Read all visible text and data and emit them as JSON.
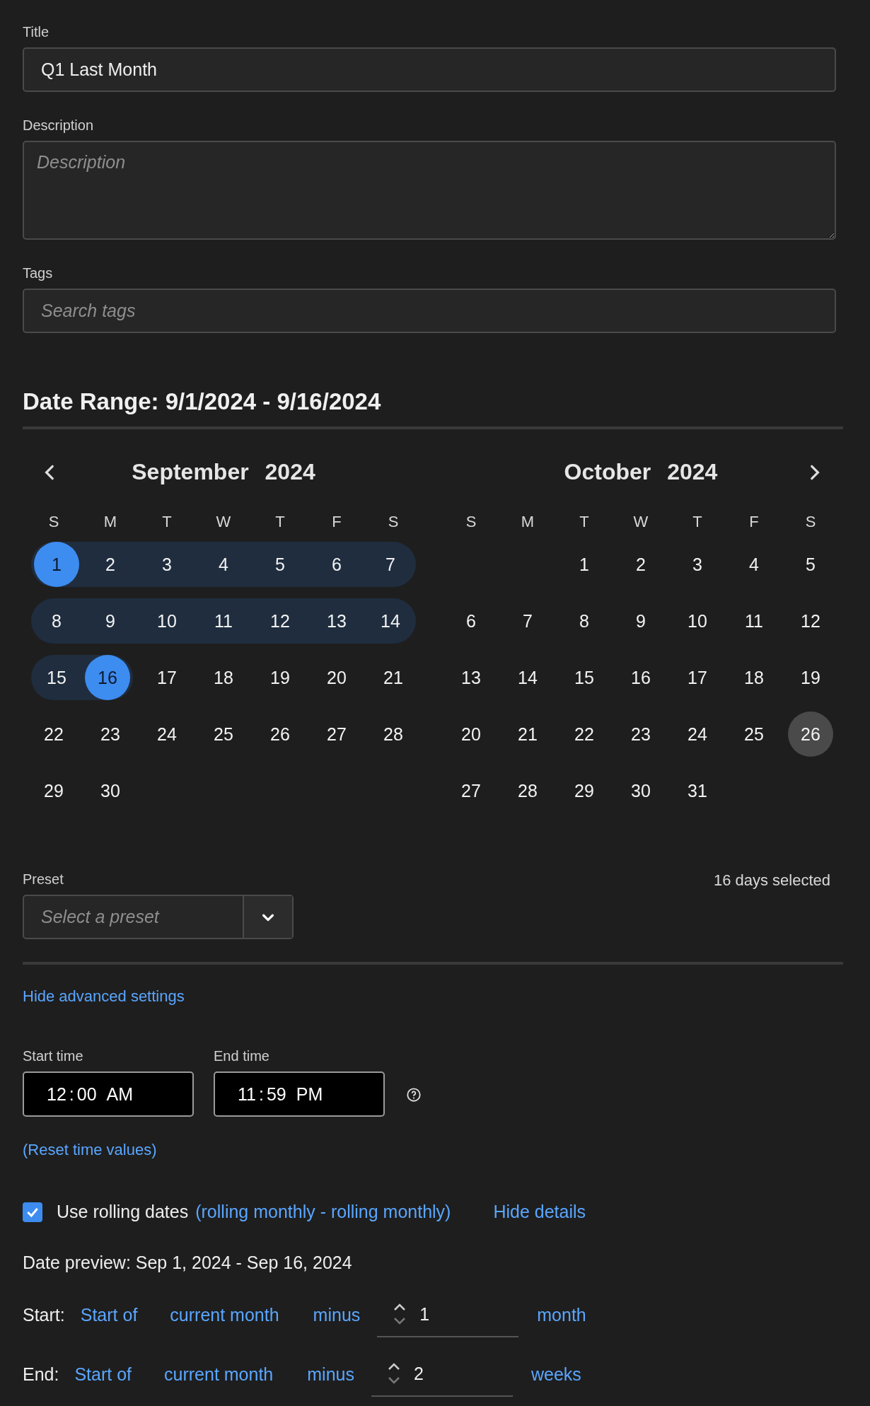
{
  "form": {
    "title": {
      "label": "Title",
      "value": "Q1 Last Month"
    },
    "description": {
      "label": "Description",
      "placeholder": "Description"
    },
    "tags": {
      "label": "Tags",
      "placeholder": "Search tags"
    }
  },
  "date_range": {
    "heading": "Date Range: 9/1/2024 - 9/16/2024"
  },
  "calendar": {
    "months": [
      {
        "month": "September",
        "year": "2024",
        "weekdays": [
          "S",
          "M",
          "T",
          "W",
          "T",
          "F",
          "S"
        ],
        "weeks": [
          [
            {
              "label": "1",
              "kind": "range_end"
            },
            {
              "label": "2",
              "kind": "range"
            },
            {
              "label": "3",
              "kind": "range"
            },
            {
              "label": "4",
              "kind": "range"
            },
            {
              "label": "5",
              "kind": "range"
            },
            {
              "label": "6",
              "kind": "range"
            },
            {
              "label": "7",
              "kind": "range"
            }
          ],
          [
            {
              "label": "8",
              "kind": "range"
            },
            {
              "label": "9",
              "kind": "range"
            },
            {
              "label": "10",
              "kind": "range"
            },
            {
              "label": "11",
              "kind": "range"
            },
            {
              "label": "12",
              "kind": "range"
            },
            {
              "label": "13",
              "kind": "range"
            },
            {
              "label": "14",
              "kind": "range"
            }
          ],
          [
            {
              "label": "15",
              "kind": "range"
            },
            {
              "label": "16",
              "kind": "range_end"
            },
            {
              "label": "17",
              "kind": "day"
            },
            {
              "label": "18",
              "kind": "day"
            },
            {
              "label": "19",
              "kind": "day"
            },
            {
              "label": "20",
              "kind": "day"
            },
            {
              "label": "21",
              "kind": "day"
            }
          ],
          [
            {
              "label": "22",
              "kind": "day"
            },
            {
              "label": "23",
              "kind": "day"
            },
            {
              "label": "24",
              "kind": "day"
            },
            {
              "label": "25",
              "kind": "day"
            },
            {
              "label": "26",
              "kind": "day"
            },
            {
              "label": "27",
              "kind": "day"
            },
            {
              "label": "28",
              "kind": "day"
            }
          ],
          [
            {
              "label": "29",
              "kind": "day"
            },
            {
              "label": "30",
              "kind": "day"
            }
          ]
        ]
      },
      {
        "month": "October",
        "year": "2024",
        "weekdays": [
          "S",
          "M",
          "T",
          "W",
          "T",
          "F",
          "S"
        ],
        "weeks": [
          [
            {
              "kind": "blank"
            },
            {
              "kind": "blank"
            },
            {
              "label": "1",
              "kind": "day"
            },
            {
              "label": "2",
              "kind": "day"
            },
            {
              "label": "3",
              "kind": "day"
            },
            {
              "label": "4",
              "kind": "day"
            },
            {
              "label": "5",
              "kind": "day"
            }
          ],
          [
            {
              "label": "6",
              "kind": "day"
            },
            {
              "label": "7",
              "kind": "day"
            },
            {
              "label": "8",
              "kind": "day"
            },
            {
              "label": "9",
              "kind": "day"
            },
            {
              "label": "10",
              "kind": "day"
            },
            {
              "label": "11",
              "kind": "day"
            },
            {
              "label": "12",
              "kind": "day"
            }
          ],
          [
            {
              "label": "13",
              "kind": "day"
            },
            {
              "label": "14",
              "kind": "day"
            },
            {
              "label": "15",
              "kind": "day"
            },
            {
              "label": "16",
              "kind": "day"
            },
            {
              "label": "17",
              "kind": "day"
            },
            {
              "label": "18",
              "kind": "day"
            },
            {
              "label": "19",
              "kind": "day"
            }
          ],
          [
            {
              "label": "20",
              "kind": "day"
            },
            {
              "label": "21",
              "kind": "day"
            },
            {
              "label": "22",
              "kind": "day"
            },
            {
              "label": "23",
              "kind": "day"
            },
            {
              "label": "24",
              "kind": "day"
            },
            {
              "label": "25",
              "kind": "day"
            },
            {
              "label": "26",
              "kind": "today"
            }
          ],
          [
            {
              "label": "27",
              "kind": "day"
            },
            {
              "label": "28",
              "kind": "day"
            },
            {
              "label": "29",
              "kind": "day"
            },
            {
              "label": "30",
              "kind": "day"
            },
            {
              "label": "31",
              "kind": "day"
            }
          ]
        ]
      }
    ]
  },
  "preset": {
    "label": "Preset",
    "placeholder": "Select a preset",
    "summary": "16 days selected"
  },
  "advanced": {
    "toggle": "Hide advanced settings",
    "times": [
      {
        "label": "Start time",
        "segments": [
          "12",
          ":",
          "00",
          "AM"
        ]
      },
      {
        "label": "End time",
        "segments": [
          "11",
          ":",
          "59",
          "PM"
        ]
      }
    ],
    "reset": "(Reset time values)"
  },
  "rolling": {
    "checked": true,
    "label": "Use rolling dates",
    "summary": "(rolling monthly - rolling monthly)",
    "details_link": "Hide details",
    "preview": "Date preview: Sep 1, 2024 - Sep 16, 2024",
    "rules": [
      {
        "label": "Start:",
        "anchor": "Start of",
        "period": "current month",
        "op": "minus",
        "amount": "1",
        "unit": "month"
      },
      {
        "label": "End:",
        "anchor": "Start of",
        "period": "current month",
        "op": "minus",
        "amount": "2",
        "unit": "weeks"
      }
    ]
  }
}
